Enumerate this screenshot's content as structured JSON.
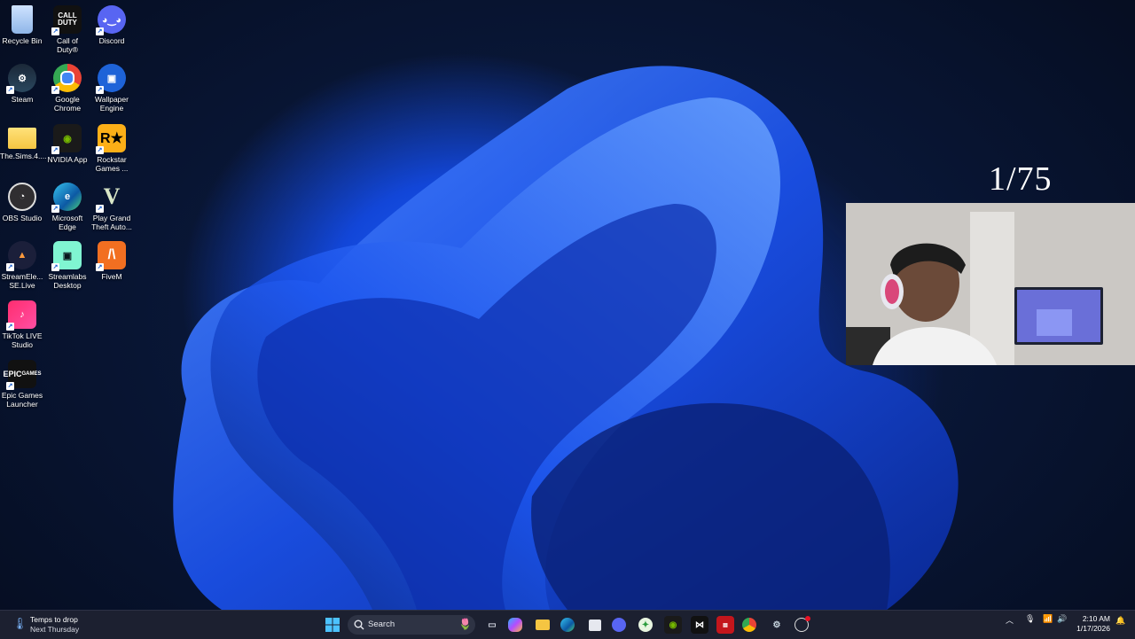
{
  "desktop": {
    "icons": [
      {
        "label": "Recycle Bin",
        "icon": "recycle-bin-icon"
      },
      {
        "label": "Call of Duty®",
        "icon": "call-of-duty-icon"
      },
      {
        "label": "Discord",
        "icon": "discord-icon"
      },
      {
        "label": "Steam",
        "icon": "steam-icon"
      },
      {
        "label": "Google Chrome",
        "icon": "chrome-icon"
      },
      {
        "label": "Wallpaper Engine",
        "icon": "wallpaper-engine-icon"
      },
      {
        "label": "The.Sims.4....",
        "icon": "folder-icon"
      },
      {
        "label": "NVIDIA App",
        "icon": "nvidia-icon"
      },
      {
        "label": "Rockstar Games ...",
        "icon": "rockstar-icon"
      },
      {
        "label": "OBS Studio",
        "icon": "obs-icon"
      },
      {
        "label": "Microsoft Edge",
        "icon": "edge-icon"
      },
      {
        "label": "Play Grand Theft Auto...",
        "icon": "gta-icon"
      },
      {
        "label": "StreamEle... SE.Live",
        "icon": "streamelements-icon"
      },
      {
        "label": "Streamlabs Desktop",
        "icon": "streamlabs-icon"
      },
      {
        "label": "FiveM",
        "icon": "fivem-icon"
      },
      {
        "label": "TikTok LIVE Studio",
        "icon": "tiktok-icon"
      },
      {
        "label": "Epic Games Launcher",
        "icon": "epic-games-icon"
      }
    ]
  },
  "overlay": {
    "counter": "1/75"
  },
  "taskbar": {
    "weather": {
      "line1": "Temps to drop",
      "line2": "Next Thursday"
    },
    "search_placeholder": "Search",
    "apps": [
      "start-icon",
      "search-icon",
      "widgets-icon",
      "task-view-icon",
      "copilot-icon",
      "file-explorer-icon",
      "edge-icon",
      "store-icon",
      "discord-icon",
      "robinhood-icon",
      "nvidia-icon",
      "capcut-icon",
      "news-icon",
      "chrome-icon",
      "steam-icon",
      "obs-icon"
    ],
    "clock": {
      "time": "2:10 AM",
      "date": "1/17/2026"
    }
  },
  "colors": {
    "accent": "#1b5fd0",
    "taskbar": "#1c2030"
  }
}
